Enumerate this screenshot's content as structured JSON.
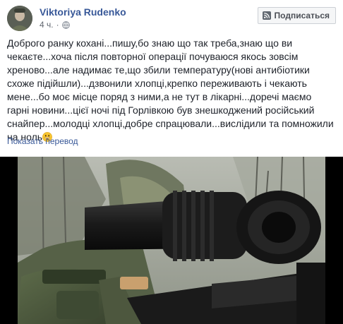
{
  "post": {
    "author": "Viktoriya Rudenko",
    "time": "4 ч.",
    "separator": "·",
    "audience_icon": "globe-icon",
    "follow_button": {
      "label": "Подписаться",
      "icon": "rss-icon"
    },
    "text": "Доброго ранку кохані...пишу,бо знаю що так треба,знаю що ви чекаєте...хоча після повторної операції почуваюся якось зовсім хреново...але надимає те,що збили температуру(нові антибіотики схоже підійшли)...дзвонили хлопці,крепко переживають і чекають мене...бо моє місце поряд з ними,а не тут в лікарні...доречі маємо гарні новини...цієї ночі під Горлівкою був знешкоджений російський снайпер...молодці хлопці,добре спрацювали...вислідили та помножили на ноль",
    "emoji": "grinning-face-emoji",
    "translate_link": "Показать перевод"
  },
  "colors": {
    "link": "#385898",
    "text": "#1d2129",
    "meta": "#616770",
    "button_bg": "#f5f6f7",
    "button_border": "#ccd0d5"
  }
}
